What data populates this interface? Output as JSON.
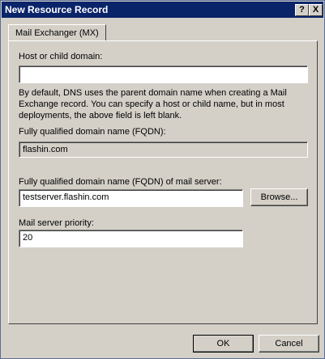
{
  "window": {
    "title": "New Resource Record",
    "help_glyph": "?",
    "close_glyph": "X"
  },
  "tabs": [
    {
      "label": "Mail Exchanger (MX)"
    }
  ],
  "form": {
    "host_label": "Host or child domain:",
    "host_value": "",
    "description": "By default, DNS uses the parent domain name when creating a Mail Exchange record. You can specify a host or child name, but in most deployments, the above field is left blank.",
    "fqdn_label": "Fully qualified domain name (FQDN):",
    "fqdn_value": "flashin.com",
    "mailserver_label": "Fully qualified domain name (FQDN) of mail server:",
    "mailserver_value": "testserver.flashin.com",
    "browse_label": "Browse...",
    "priority_label": "Mail server priority:",
    "priority_value": "20"
  },
  "footer": {
    "ok_label": "OK",
    "cancel_label": "Cancel"
  }
}
